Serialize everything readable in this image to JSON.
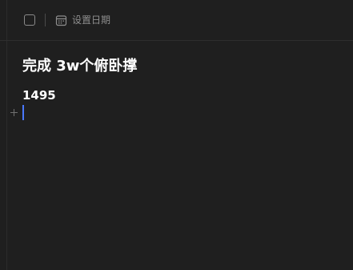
{
  "toolbar": {
    "date_label": "设置日期",
    "checkbox_checked": false
  },
  "task": {
    "title": "完成 3w个俯卧撑",
    "note": "1495"
  },
  "colors": {
    "background": "#1f1f1f",
    "text_primary": "#ffffff",
    "text_muted": "#8e8e8e",
    "caret": "#4a78ff"
  },
  "icons": {
    "checkbox": "checkbox-icon",
    "calendar": "calendar-icon",
    "add_block": "plus-icon"
  }
}
